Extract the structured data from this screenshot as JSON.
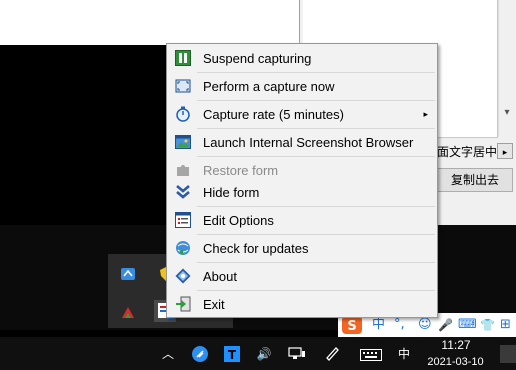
{
  "context_menu": {
    "items": [
      {
        "label": "Suspend capturing",
        "icon": "pause-icon",
        "enabled": true
      },
      {
        "label": "Perform a capture now",
        "icon": "capture-frame-icon",
        "enabled": true
      },
      {
        "label": "Capture rate (5 minutes)",
        "icon": "stopwatch-icon",
        "enabled": true,
        "has_submenu": true
      },
      {
        "label": "Launch Internal Screenshot Browser",
        "icon": "screenshot-browser-icon",
        "enabled": true
      },
      {
        "label": "Restore form",
        "icon": "puzzle-icon",
        "enabled": false
      },
      {
        "label": "Hide form",
        "icon": "chevron-double-down-icon",
        "enabled": true
      },
      {
        "label": "Edit Options",
        "icon": "options-list-icon",
        "enabled": true
      },
      {
        "label": "Check for updates",
        "icon": "globe-update-icon",
        "enabled": true
      },
      {
        "label": "About",
        "icon": "about-diamond-icon",
        "enabled": true
      },
      {
        "label": "Exit",
        "icon": "exit-door-icon",
        "enabled": true
      }
    ],
    "submenu_arrow": "▸"
  },
  "background_window": {
    "align_label": "面文字居中",
    "align_arrow": "▸",
    "copy_button": "复制出去",
    "scroll_down": "▾"
  },
  "ime_toolbar": {
    "items": [
      "中",
      "°,",
      "☺",
      "🎤",
      "⌨",
      "👕",
      "⊞"
    ]
  },
  "taskbar": {
    "show_hidden_icons": "︿",
    "volume": "🔊",
    "input_method": "中",
    "time": "11:27",
    "date": "2021-03-10"
  },
  "colors": {
    "menu_bg": "#f2f2f2",
    "menu_border": "#979797",
    "disabled_text": "#8a8a8a",
    "taskbar": "#101010",
    "accent_blue": "#1e73d8",
    "sogou_orange": "#f26522"
  }
}
